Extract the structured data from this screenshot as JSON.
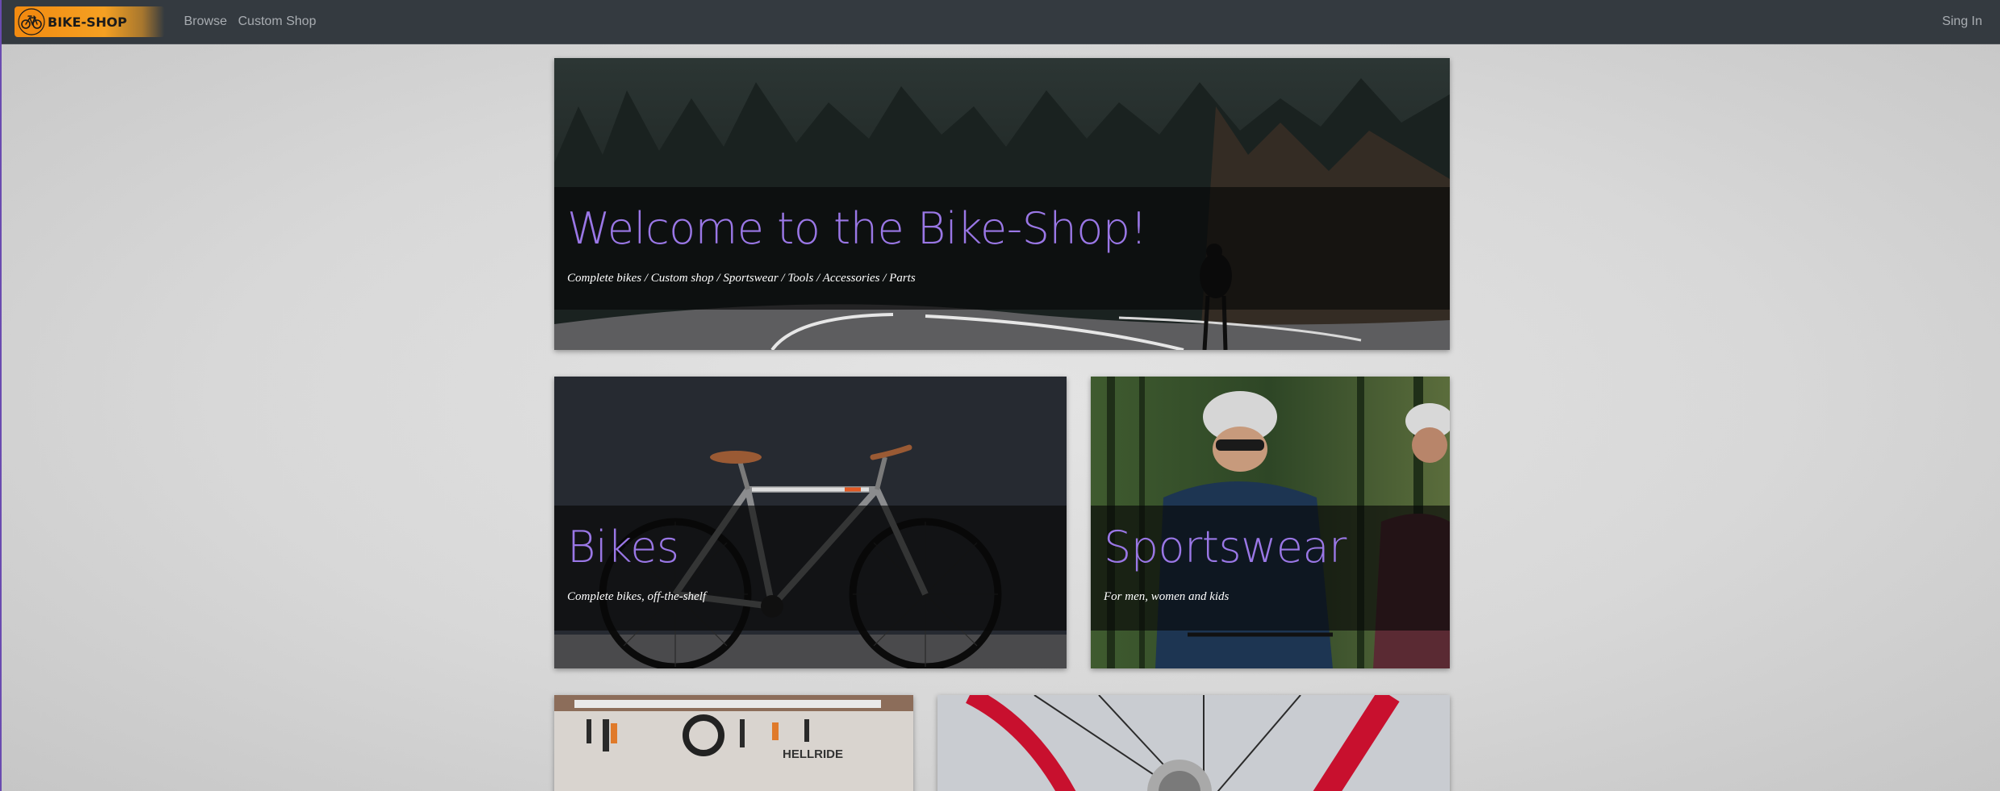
{
  "navbar": {
    "brand_label": "BIKE-SHOP",
    "brand_icon": "bicycle-icon",
    "brand_color": "#f28a10",
    "links": [
      {
        "label": "Browse"
      },
      {
        "label": "Custom Shop"
      }
    ],
    "sign_in_label": "Sing In"
  },
  "hero": {
    "title": "Welcome to the Bike-Shop!",
    "subtitle": "Complete bikes / Custom shop / Sportswear / Tools / Accessories / Parts"
  },
  "categories": [
    {
      "title": "Bikes",
      "subtitle": "Complete bikes, off-the-shelf"
    },
    {
      "title": "Sportswear",
      "subtitle": "For men, women and kids"
    }
  ],
  "colors": {
    "accent": "#9a77e6",
    "navbar_bg": "#343a40",
    "nav_text": "#a9adb2"
  }
}
